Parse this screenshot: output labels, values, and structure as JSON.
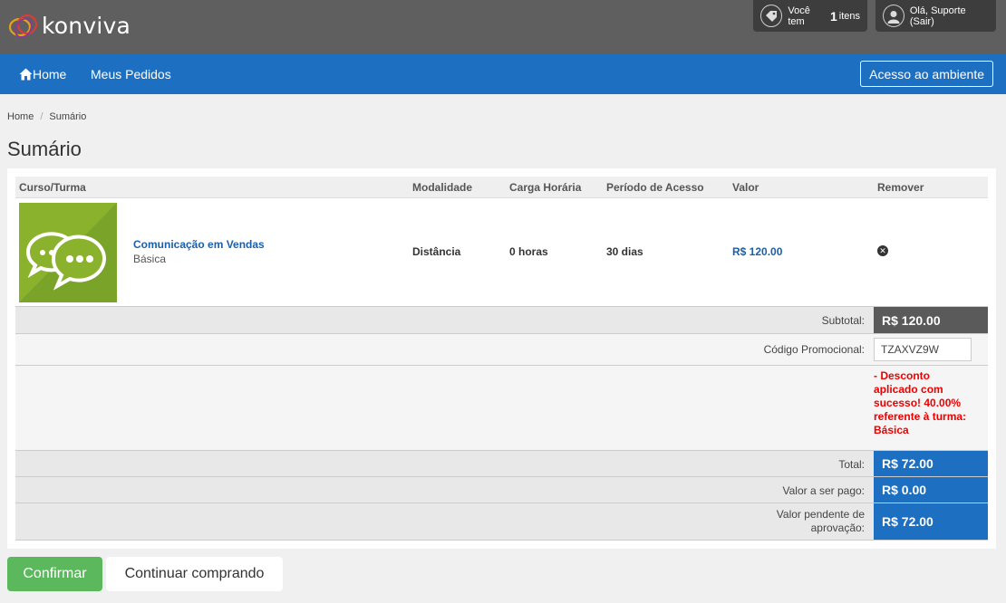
{
  "header": {
    "logo_text": "konviva",
    "cart_prefix": "Você tem",
    "cart_count": "1",
    "cart_suffix": "itens",
    "user_text": "Olá, Suporte (Sair)"
  },
  "nav": {
    "home": "Home",
    "orders": "Meus Pedidos",
    "access": "Acesso ao ambiente"
  },
  "breadcrumb": [
    "Home",
    "Sumário"
  ],
  "page_title": "Sumário",
  "table": {
    "headers": [
      "Curso/Turma",
      "Modalidade",
      "Carga Horária",
      "Período de Acesso",
      "Valor",
      "Remover"
    ],
    "rows": [
      {
        "course": "Comunicação em Vendas",
        "class": "Básica",
        "modality": "Distância",
        "hours": "0 horas",
        "access": "30 dias",
        "price": "R$ 120.00"
      }
    ]
  },
  "summary": {
    "subtotal_label": "Subtotal:",
    "subtotal_value": "R$ 120.00",
    "promo_label": "Código Promocional:",
    "promo_value": "TZAXVZ9W",
    "discount_message": "- Desconto aplicado com sucesso! 40.00% referente à turma: Básica",
    "total_label": "Total:",
    "total_value": "R$ 72.00",
    "to_pay_label": "Valor a ser pago:",
    "to_pay_value": "R$ 0.00",
    "pending_label": "Valor pendente de aprovação:",
    "pending_value": "R$ 72.00"
  },
  "actions": {
    "confirm": "Confirmar",
    "continue": "Continuar comprando"
  },
  "colors": {
    "topbar": "#5f5f5f",
    "nav": "#1c6fc1",
    "confirm": "#5cb85c",
    "thumb": "#8ab22c"
  }
}
